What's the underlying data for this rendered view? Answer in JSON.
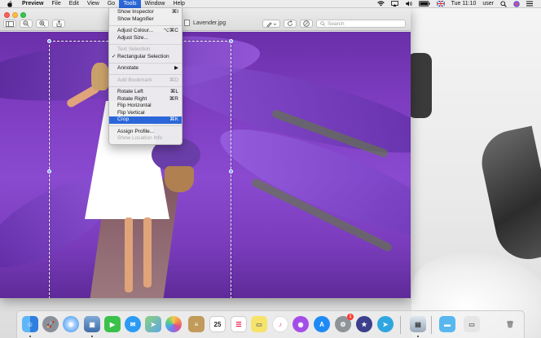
{
  "menubar": {
    "app_name": "Preview",
    "items": [
      "File",
      "Edit",
      "View",
      "Go",
      "Tools",
      "Window",
      "Help"
    ],
    "active_item": "Tools",
    "status": {
      "day_time": "Tue 11:10",
      "user": "user"
    }
  },
  "window": {
    "document_title": "Lavender.jpg",
    "search_placeholder": "Search"
  },
  "tools_menu": {
    "items": [
      {
        "label": "Show Inspector",
        "shortcut": "⌘I",
        "enabled": true
      },
      {
        "label": "Show Magnifier",
        "shortcut": "",
        "enabled": true
      },
      {
        "label": "Adjust Colour...",
        "shortcut": "⌥⌘C",
        "enabled": true
      },
      {
        "label": "Adjust Size...",
        "shortcut": "",
        "enabled": true
      },
      {
        "label": "Text Selection",
        "shortcut": "",
        "enabled": false
      },
      {
        "label": "Rectangular Selection",
        "shortcut": "",
        "enabled": true,
        "checked": true
      },
      {
        "label": "Annotate",
        "shortcut": "▶",
        "enabled": true
      },
      {
        "label": "Add Bookmark",
        "shortcut": "⌘D",
        "enabled": false
      },
      {
        "label": "Rotate Left",
        "shortcut": "⌘L",
        "enabled": true
      },
      {
        "label": "Rotate Right",
        "shortcut": "⌘R",
        "enabled": true
      },
      {
        "label": "Flip Horizontal",
        "shortcut": "",
        "enabled": true
      },
      {
        "label": "Flip Vertical",
        "shortcut": "",
        "enabled": true
      },
      {
        "label": "Crop",
        "shortcut": "⌘K",
        "enabled": true,
        "highlighted": true
      },
      {
        "label": "Assign Profile...",
        "shortcut": "",
        "enabled": true
      },
      {
        "label": "Show Location Info",
        "shortcut": "",
        "enabled": false
      }
    ]
  },
  "dock": {
    "calendar_day": "25",
    "system_prefs_badge": "1",
    "apps": [
      "finder",
      "launchpad",
      "safari",
      "photos-viewer",
      "facetime",
      "messages",
      "maps",
      "photos",
      "notes",
      "calendar",
      "reminders",
      "stickies",
      "music",
      "podcasts",
      "app-store",
      "system-preferences",
      "imovie",
      "telegram",
      "preview",
      "downloads-folder",
      "recents",
      "trash"
    ]
  },
  "colors": {
    "menu_highlight": "#2b67d9",
    "lavender": "#8a4ad0",
    "selection_handle": "#7aa9ff"
  }
}
